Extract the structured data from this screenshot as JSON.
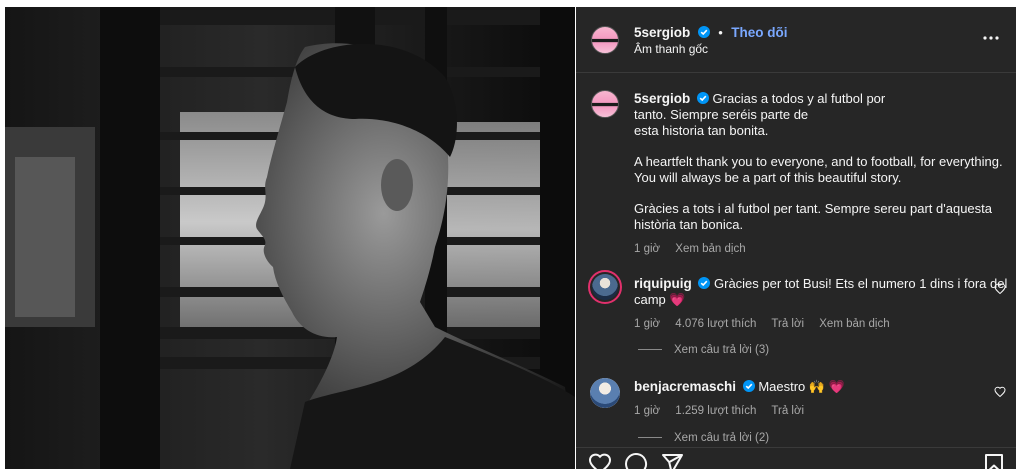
{
  "header": {
    "username": "5sergiob",
    "separator": "•",
    "follow_label": "Theo dõi",
    "audio_label": "Âm thanh gốc"
  },
  "caption": {
    "username": "5sergiob",
    "line1": "Gracias a todos y al futbol por",
    "line2": "tanto. Siempre seréis parte de",
    "line3": "esta historia tan bonita.",
    "en1": "A heartfelt thank you to everyone, and to football, for everything.",
    "en2": "You will always be a part of this beautiful story.",
    "ca1": "Gràcies a tots i al futbol per tant. Sempre sereu part d'aquesta",
    "ca2": "història tan bonica.",
    "time": "1 giờ",
    "translate": "Xem bản dịch"
  },
  "comments": [
    {
      "username": "riquipuig",
      "text1": "Gràcies per tot Busi! Ets el numero 1 dins i fora del",
      "text2": "camp",
      "emoji": "💗",
      "time": "1 giờ",
      "likes": "4.076 lượt thích",
      "reply": "Trả lời",
      "translate": "Xem bản dịch",
      "view_replies": "Xem câu trả lời (3)"
    },
    {
      "username": "benjacremaschi",
      "text1": "Maestro",
      "emoji": "🙌 💗",
      "time": "1 giờ",
      "likes": "1.259 lượt thích",
      "reply": "Trả lời",
      "view_replies": "Xem câu trả lời (2)"
    }
  ],
  "icons": [
    "more-options-icon",
    "verified-badge-icon",
    "heart-icon",
    "comment-icon",
    "share-icon",
    "bookmark-icon"
  ],
  "colors": {
    "panel_bg": "#262626",
    "link_blue": "#7aa8ff",
    "verified": "#0095f6",
    "muted": "#a8a8a8"
  }
}
